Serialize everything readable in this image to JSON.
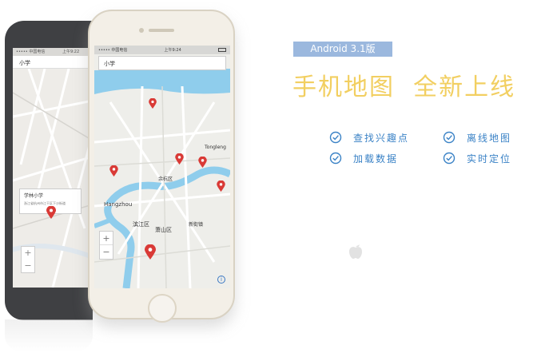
{
  "badge": {
    "text": "Android 3.1版"
  },
  "headline": {
    "part1": "手机地图",
    "part2": "全新上线"
  },
  "features": [
    {
      "label": "查找兴趣点"
    },
    {
      "label": "离线地图"
    },
    {
      "label": "加载数据"
    },
    {
      "label": "实时定位"
    }
  ],
  "front_phone": {
    "status_carrier": "••••• 中国电信",
    "status_time": "上午9:24",
    "search_value": "小学",
    "zoom_in": "+",
    "zoom_out": "−",
    "info": "i",
    "map_labels": {
      "hangzhou": "Hangzhou",
      "binjiang": "滨江区",
      "xiaoshan": "萧山区",
      "xinjie": "新街镇",
      "yuhang": "余杭区",
      "tongleng": "Tongleng"
    }
  },
  "back_phone": {
    "status_carrier": "••••• 中国电信",
    "status_time": "上午9:22",
    "search_value": "小学",
    "popup_title": "学林小学",
    "popup_sub": "浙江省杭州市江干区下沙街道",
    "zoom_in": "+",
    "zoom_out": "−"
  },
  "colors": {
    "accent_blue": "#3a82c6",
    "headline_yellow": "#f2cf61",
    "badge_bg": "#9bb8de",
    "pin_red": "#d93a36",
    "water": "#8fcdec"
  },
  "icons": [
    "check-circle-icon",
    "map-pin-icon",
    "apple-logo-icon",
    "info-icon"
  ]
}
